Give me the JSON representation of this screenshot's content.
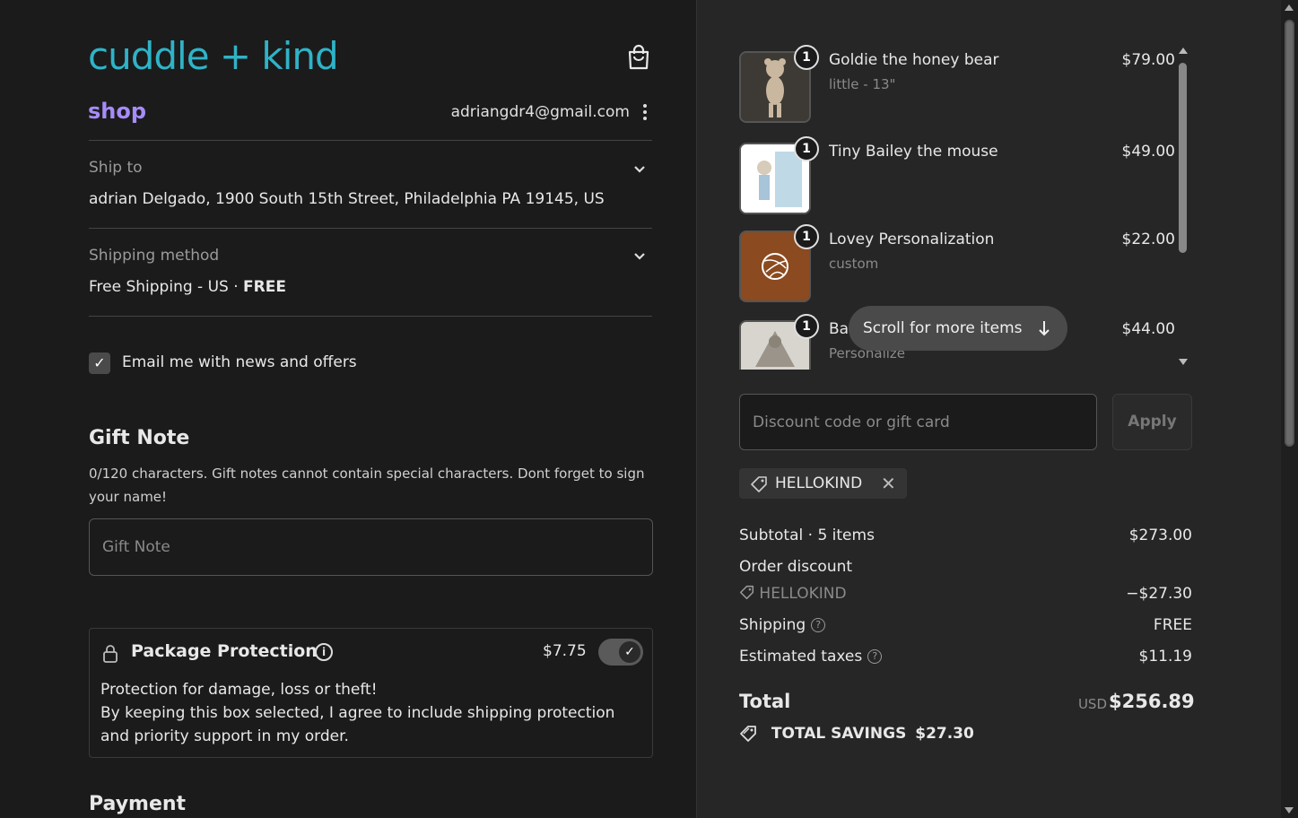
{
  "brand": {
    "logo_text": "cuddle + kind",
    "shop_label": "shop"
  },
  "account": {
    "email": "adriangdr4@gmail.com"
  },
  "ship_to": {
    "label": "Ship to",
    "value": "adrian Delgado, 1900 South 15th Street, Philadelphia PA 19145, US"
  },
  "shipping_method": {
    "label": "Shipping method",
    "value": "Free Shipping - US",
    "separator": "·",
    "price": "FREE"
  },
  "newsletter": {
    "checked": true,
    "label": "Email me with news and offers"
  },
  "gift_note": {
    "heading": "Gift Note",
    "help": "0/120 characters. Gift notes cannot contain special characters. Dont forget to sign your name!",
    "placeholder": "Gift Note",
    "value": ""
  },
  "package_protection": {
    "title": "Package Protection",
    "price": "$7.75",
    "enabled": true,
    "line1": "Protection for damage, loss or theft!",
    "line2": "By keeping this box selected, I agree to include shipping protection and priority support in my order."
  },
  "payment": {
    "heading": "Payment"
  },
  "cart": {
    "items": [
      {
        "qty": "1",
        "name": "Goldie the honey bear",
        "variant": "little - 13\"",
        "price": "$79.00"
      },
      {
        "qty": "1",
        "name": "Tiny Bailey the mouse",
        "variant": "",
        "price": "$49.00"
      },
      {
        "qty": "1",
        "name": "Lovey Personalization",
        "variant": "custom",
        "price": "$22.00"
      },
      {
        "qty": "1",
        "name": "Ba",
        "variant": "Personalize",
        "price": "$44.00"
      }
    ],
    "scroll_hint": "Scroll for more items"
  },
  "discount": {
    "placeholder": "Discount code or gift card",
    "apply_label": "Apply",
    "applied_code": "HELLOKIND"
  },
  "summary": {
    "subtotal_label": "Subtotal · 5 items",
    "subtotal_value": "$273.00",
    "order_discount_label": "Order discount",
    "discount_code": "HELLOKIND",
    "discount_value": "−$27.30",
    "shipping_label": "Shipping",
    "shipping_value": "FREE",
    "taxes_label": "Estimated taxes",
    "taxes_value": "$11.19",
    "total_label": "Total",
    "currency": "USD",
    "total_value": "$256.89",
    "savings_label": "TOTAL SAVINGS",
    "savings_value": "$27.30"
  },
  "colors": {
    "brand": "#2fb3c7",
    "shop": "#a78bfa",
    "background_left": "#1b1b1b",
    "background_right": "#262626"
  },
  "icons": [
    "bag-icon",
    "kebab-icon",
    "chevron-down-icon",
    "check-icon",
    "lock-icon",
    "info-icon",
    "arrow-down-icon",
    "tag-icon",
    "close-icon",
    "question-icon"
  ]
}
